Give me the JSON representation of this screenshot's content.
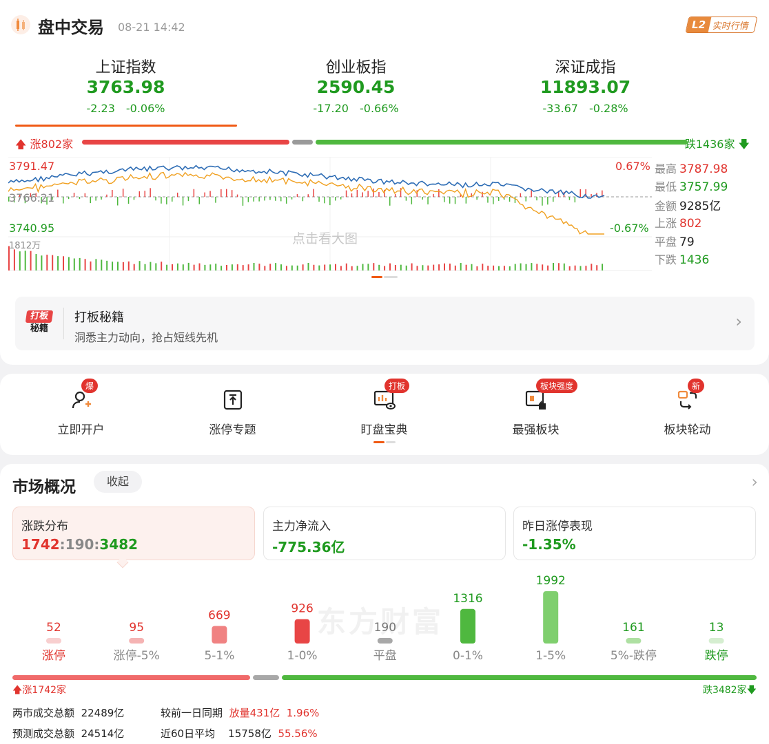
{
  "header": {
    "title": "盘中交易",
    "time": "08-21 14:42",
    "badge_l2": "L2",
    "badge_text": "实时行情"
  },
  "indices": [
    {
      "name": "上证指数",
      "value": "3763.98",
      "change": "-2.23",
      "pct": "-0.06%"
    },
    {
      "name": "创业板指",
      "value": "2590.45",
      "change": "-17.20",
      "pct": "-0.66%"
    },
    {
      "name": "深证成指",
      "value": "11893.07",
      "change": "-33.67",
      "pct": "-0.28%"
    }
  ],
  "breadth": {
    "up_label": "涨802家",
    "down_label": "跌1436家",
    "up": 802,
    "flat": 79,
    "down": 1436
  },
  "chart": {
    "y_high": "3791.47",
    "y_mid": "3766.21",
    "y_low": "3740.95",
    "vol_label": "1812万",
    "pct_high": "0.67%",
    "pct_low": "-0.67%",
    "watermark": "点击看大图",
    "high_label": "最高",
    "high": "3787.98",
    "low_label": "最低",
    "low": "3757.99",
    "amount_label": "金额",
    "amount": "9285亿",
    "rise_label": "上涨",
    "rise": "802",
    "flat_label": "平盘",
    "flat": "79",
    "fall_label": "下跌",
    "fall": "1436"
  },
  "promo": {
    "icon_line1": "打板",
    "icon_line2": "秘籍",
    "title": "打板秘籍",
    "subtitle": "洞悉主力动向，抢占短线先机"
  },
  "quick": [
    {
      "label": "立即开户",
      "badge": "爆"
    },
    {
      "label": "涨停专题",
      "badge": ""
    },
    {
      "label": "盯盘宝典",
      "badge": "打板"
    },
    {
      "label": "最强板块",
      "badge": "板块强度"
    },
    {
      "label": "板块轮动",
      "badge": "新"
    }
  ],
  "market": {
    "title": "市场概况",
    "collapse": "收起",
    "cards": [
      {
        "title": "涨跌分布",
        "up": "1742",
        "sep1": ":",
        "flat": "190",
        "sep2": ":",
        "down": "3482"
      },
      {
        "title": "主力净流入",
        "value": "-775.36亿"
      },
      {
        "title": "昨日涨停表现",
        "value": "-1.35%"
      }
    ],
    "watermark": "东方财富"
  },
  "chart_data": {
    "type": "bar",
    "categories": [
      "涨停",
      "涨停-5%",
      "5-1%",
      "1-0%",
      "平盘",
      "0-1%",
      "1-5%",
      "5%-跌停",
      "跌停"
    ],
    "values": [
      52,
      95,
      669,
      926,
      190,
      1316,
      1992,
      161,
      13
    ],
    "colors": [
      "#f8cfcf",
      "#f5b3b3",
      "#f08282",
      "#e84545",
      "#a8a8a8",
      "#4fb83f",
      "#7fcf6e",
      "#aee0a2",
      "#d5eed0"
    ]
  },
  "breadth2": {
    "up_label": "涨1742家",
    "down_label": "跌3482家",
    "up": 1742,
    "flat": 190,
    "down": 3482
  },
  "turnover": {
    "row1": {
      "k1": "两市成交总额",
      "v1": "22489亿",
      "k2": "较前一日同期",
      "v2": "放量431亿",
      "v3": "1.96%"
    },
    "row2": {
      "k1": "预测成交总额",
      "v1": "24514亿",
      "k2": "近60日平均",
      "v2": "15758亿",
      "v3": "55.56%"
    }
  }
}
